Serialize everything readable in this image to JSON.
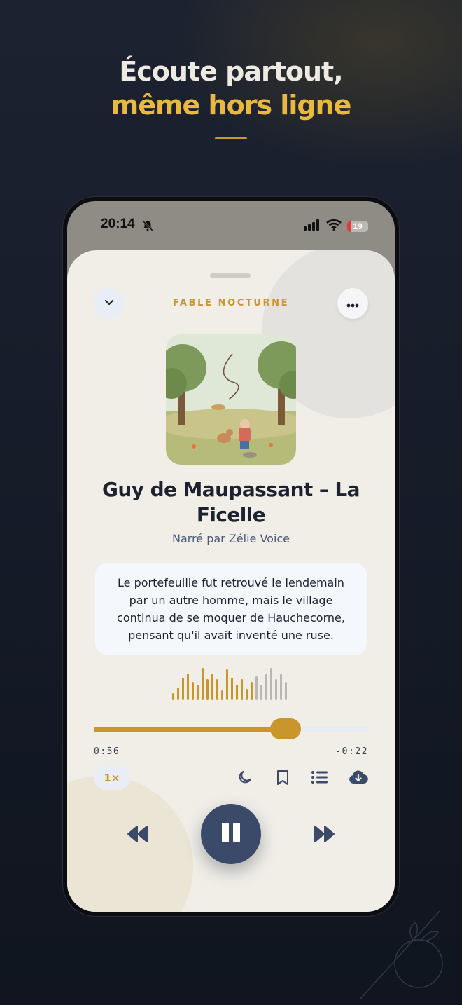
{
  "promo": {
    "line1": "Écoute partout,",
    "line2": "même hors ligne"
  },
  "status_bar": {
    "time": "20:14",
    "battery": "19"
  },
  "player": {
    "kicker": "FABLE NOCTURNE",
    "title": "Guy de Maupassant – La Ficelle",
    "narrator": "Narré par Zélie Voice",
    "quote": "Le portefeuille fut retrouvé le lendemain par un autre homme, mais le village continua de se moquer de Hauchecorne, pensant qu'il avait inventé une ruse.",
    "elapsed": "0:56",
    "remaining": "-0:22",
    "progress_fraction": 0.7,
    "speed": "1×",
    "state": "playing"
  },
  "colors": {
    "accent": "#c9962c",
    "accent_light": "#e9b93f",
    "primary": "#3b4a68",
    "background": "#141a26",
    "sheet": "#f1eee8"
  },
  "icons": {
    "collapse": "chevron-down-icon",
    "more": "more-horizontal-icon",
    "sleep": "moon-icon",
    "bookmark": "bookmark-icon",
    "queue": "list-icon",
    "download": "cloud-download-icon",
    "rewind": "rewind-icon",
    "play_pause": "pause-icon",
    "forward": "fast-forward-icon"
  }
}
